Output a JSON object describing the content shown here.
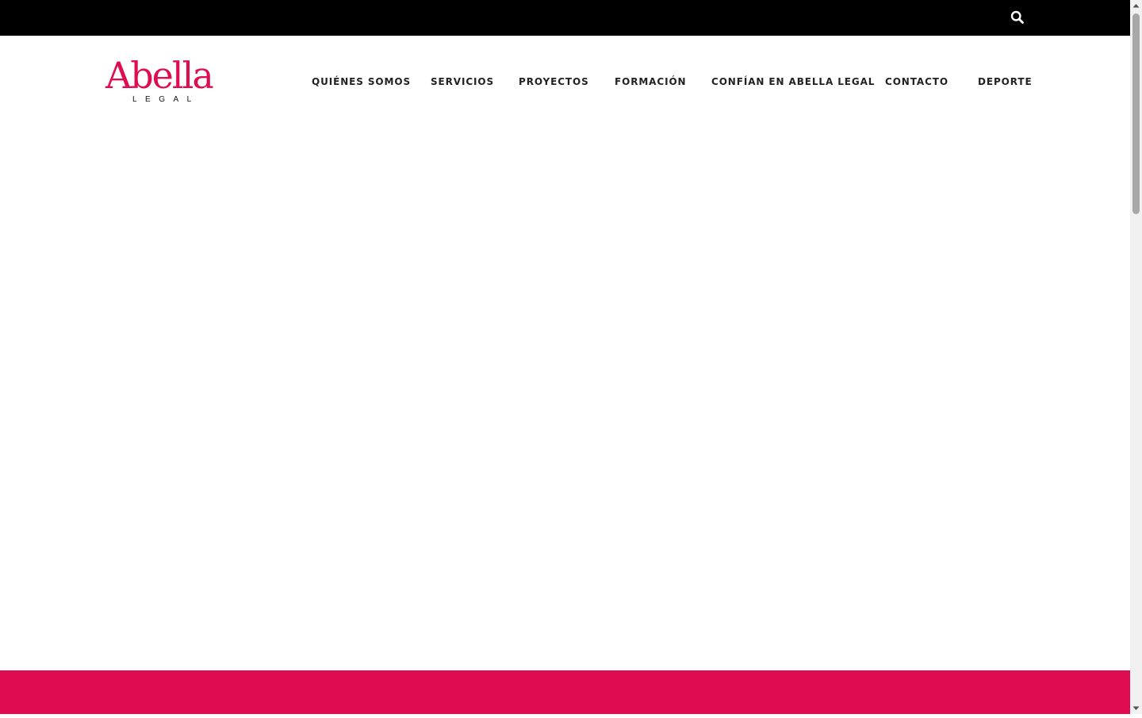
{
  "colors": {
    "brand": "#E00C50",
    "topbar": "#000000",
    "nav_text": "#222222"
  },
  "topbar": {
    "search_icon": "search-icon"
  },
  "logo": {
    "word": "Abella",
    "sub": "LEGAL"
  },
  "nav": {
    "items": [
      {
        "label": "QUIÉNES SOMOS"
      },
      {
        "label": "SERVICIOS"
      },
      {
        "label": "PROYECTOS"
      },
      {
        "label": "FORMACIÓN"
      },
      {
        "label": "CONFÍAN EN ABELLA LEGAL"
      },
      {
        "label": "CONTACTO"
      },
      {
        "label": "DEPORTE"
      }
    ]
  },
  "scrollbar": {
    "position": 0
  }
}
